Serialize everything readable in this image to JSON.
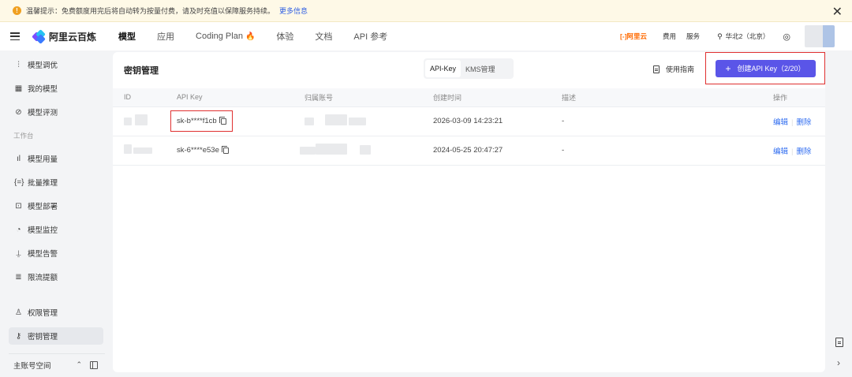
{
  "notice": {
    "icon": "warning-icon",
    "text": "温馨提示：免费额度用完后将自动转为按量付费，请及时充值以保障服务持续。",
    "link": "更多信息"
  },
  "topnav": {
    "brand": "阿里云百炼",
    "tabs": [
      "模型",
      "应用",
      "Coding Plan",
      "体验",
      "文档",
      "API 参考"
    ],
    "active_tab": "模型",
    "aliyun_logo": "[-]阿里云",
    "links": [
      "费用",
      "服务"
    ],
    "region": "华北2（北京）"
  },
  "sidebar": {
    "items_top": [
      {
        "label": "模型调优",
        "icon": "tune-icon"
      },
      {
        "label": "我的模型",
        "icon": "grid-icon"
      },
      {
        "label": "模型评测",
        "icon": "compass-icon"
      }
    ],
    "group_label": "工作台",
    "items_work": [
      {
        "label": "模型用量",
        "icon": "bar-chart-icon"
      },
      {
        "label": "批量推理",
        "icon": "braces-icon"
      },
      {
        "label": "模型部署",
        "icon": "deploy-icon"
      },
      {
        "label": "模型监控",
        "icon": "pie-chart-icon"
      },
      {
        "label": "模型告警",
        "icon": "alarm-icon"
      },
      {
        "label": "限流提额",
        "icon": "database-icon"
      }
    ],
    "items_bottom": [
      {
        "label": "权限管理",
        "icon": "user-icon"
      },
      {
        "label": "密钥管理",
        "icon": "key-icon"
      }
    ],
    "active": "密钥管理",
    "workspace": "主账号空间"
  },
  "main": {
    "title": "密钥管理",
    "segments": [
      "API-Key",
      "KMS管理"
    ],
    "active_segment": "API-Key",
    "guide": "使用指南",
    "create_button": "创建API Key（2/20）",
    "columns": [
      "ID",
      "API Key",
      "归属账号",
      "创建时间",
      "描述",
      "操作"
    ],
    "rows": [
      {
        "key": "sk-b****f1cb",
        "created": "2026-03-09 14:23:21",
        "desc": "-",
        "edit": "编辑",
        "delete": "删除"
      },
      {
        "key": "sk-6****e53e",
        "created": "2024-05-25 20:47:27",
        "desc": "-",
        "edit": "编辑",
        "delete": "删除"
      }
    ]
  },
  "colors": {
    "accent": "#5a55e8",
    "link": "#2f6cf0",
    "highlight_box": "#e03030",
    "notice_bg": "#fef9e7"
  }
}
